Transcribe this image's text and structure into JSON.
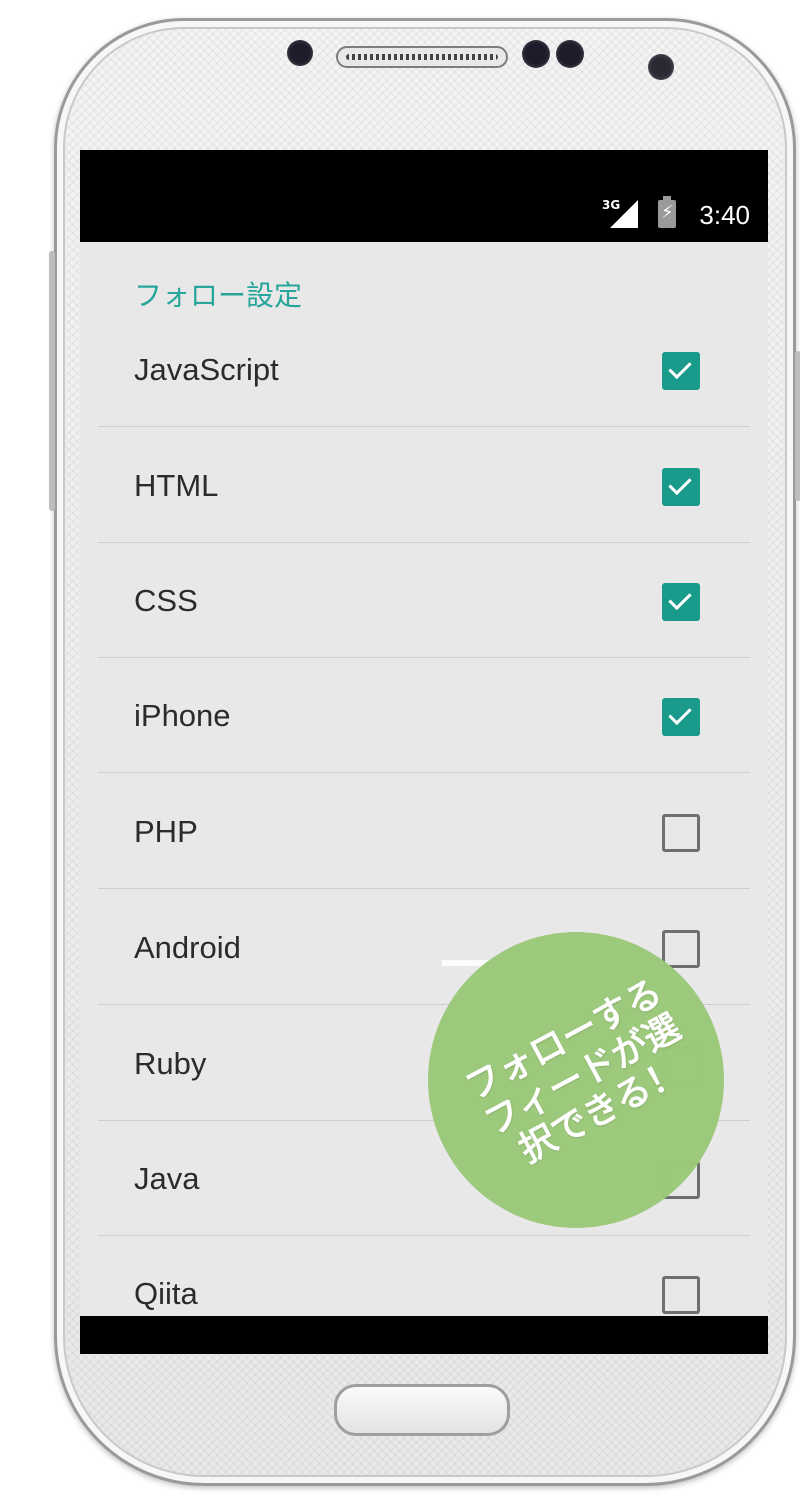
{
  "status_bar": {
    "network": "3G",
    "time": "3:40"
  },
  "section_title": "フォロー設定",
  "items": [
    {
      "label": "JavaScript",
      "checked": true
    },
    {
      "label": "HTML",
      "checked": true
    },
    {
      "label": "CSS",
      "checked": true
    },
    {
      "label": "iPhone",
      "checked": true
    },
    {
      "label": "PHP",
      "checked": false
    },
    {
      "label": "Android",
      "checked": false
    },
    {
      "label": "Ruby",
      "checked": false
    },
    {
      "label": "Java",
      "checked": false
    },
    {
      "label": "Qiita",
      "checked": false
    }
  ],
  "promo_badge": {
    "line1": "フォローする",
    "line2": "フィードが選",
    "line3": "択できる！",
    "color": "#9cc97a"
  },
  "colors": {
    "accent": "#26a69a",
    "checkbox_checked": "#1a9a8b",
    "background": "#e8e8e8"
  }
}
